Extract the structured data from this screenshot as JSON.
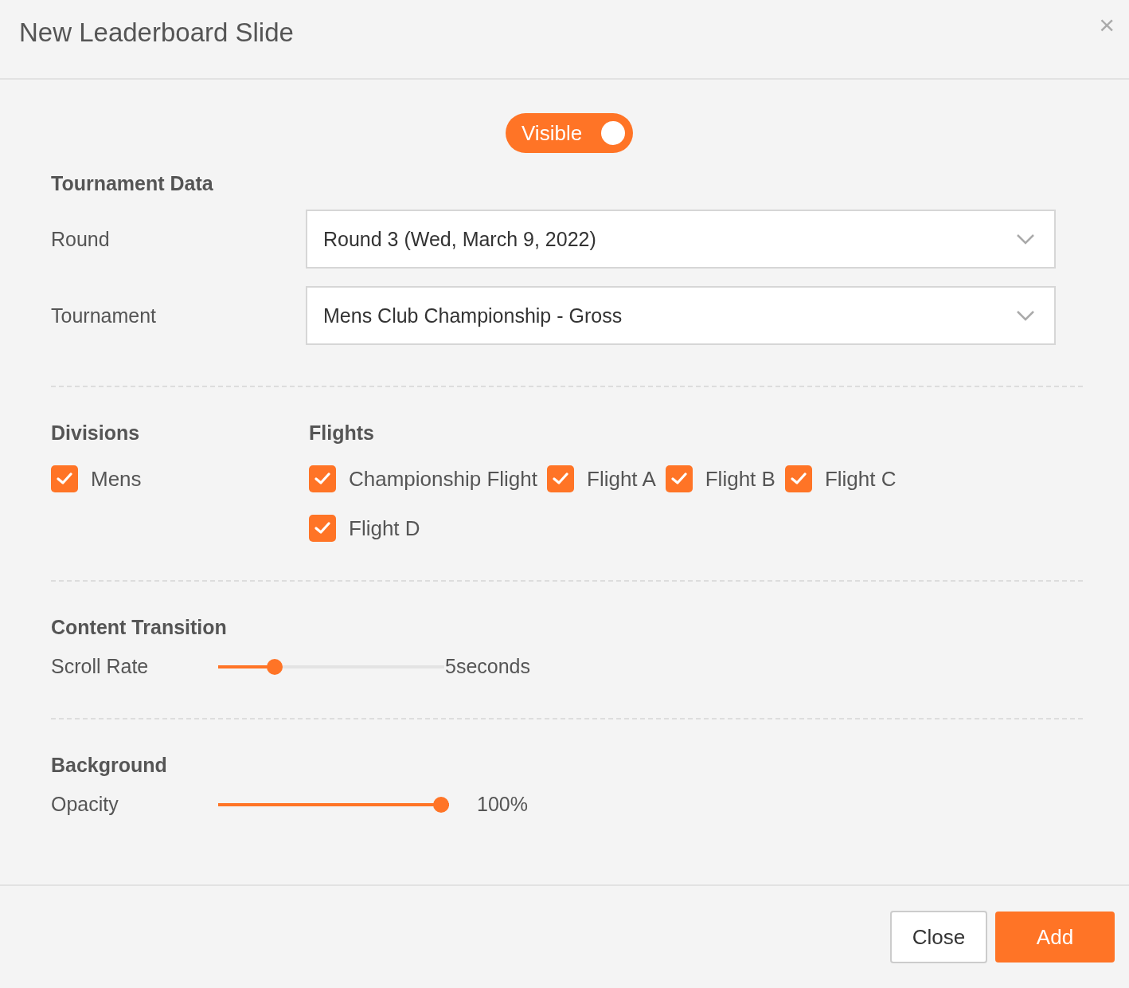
{
  "dialog": {
    "title": "New Leaderboard Slide",
    "close_glyph": "×"
  },
  "visibility_toggle": {
    "label": "Visible",
    "on": true
  },
  "tournament_data": {
    "heading": "Tournament Data",
    "fields": [
      {
        "label": "Round",
        "value": "Round 3 (Wed, March 9, 2022)"
      },
      {
        "label": "Tournament",
        "value": "Mens Club Championship - Gross"
      }
    ]
  },
  "divisions": {
    "heading": "Divisions",
    "items": [
      {
        "label": "Mens",
        "checked": true
      }
    ]
  },
  "flights": {
    "heading": "Flights",
    "items": [
      {
        "label": "Championship Flight",
        "checked": true
      },
      {
        "label": "Flight A",
        "checked": true
      },
      {
        "label": "Flight B",
        "checked": true
      },
      {
        "label": "Flight C",
        "checked": true
      },
      {
        "label": "Flight D",
        "checked": true
      }
    ]
  },
  "content_transition": {
    "heading": "Content Transition",
    "sliders": [
      {
        "label": "Scroll Rate",
        "level": 0.23,
        "reading": "5seconds"
      }
    ]
  },
  "background": {
    "heading": "Background",
    "sliders": [
      {
        "label": "Opacity",
        "level": 1,
        "reading": "100%"
      }
    ]
  },
  "buttons": [
    {
      "label": "Close",
      "kind": "secondary"
    },
    {
      "label": "Add",
      "kind": "primary"
    }
  ]
}
